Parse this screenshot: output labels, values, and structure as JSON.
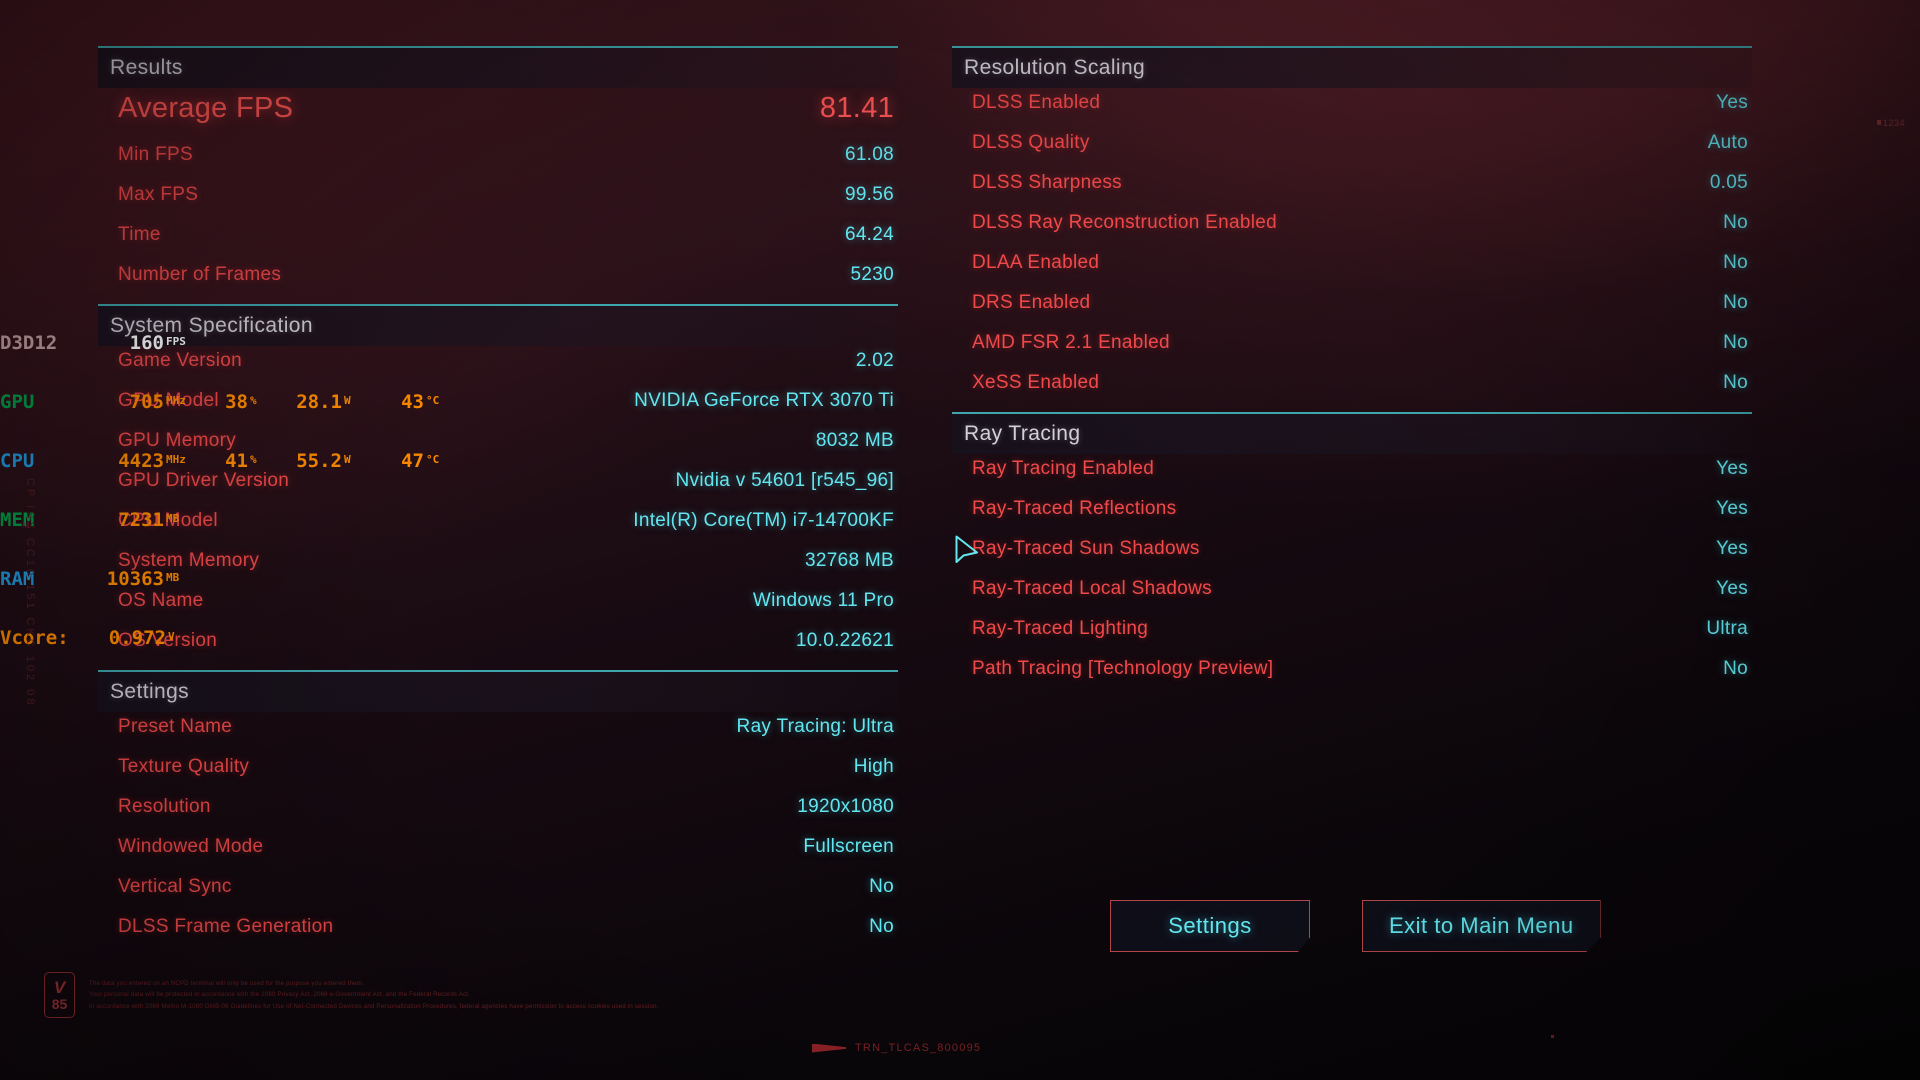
{
  "theme": {
    "accent_teal": "#3fa6ad",
    "label_red": "#f0494a",
    "value_cyan": "#63e6ef",
    "highlight_red": "#fe5453",
    "header_text": "#d3d0d6",
    "button_border": "#b4464a"
  },
  "left_column": {
    "results": {
      "title": "Results",
      "rows": [
        {
          "label": "Average FPS",
          "value": "81.41",
          "emphasis": true
        },
        {
          "label": "Min FPS",
          "value": "61.08",
          "emphasis": false
        },
        {
          "label": "Max FPS",
          "value": "99.56",
          "emphasis": false
        },
        {
          "label": "Time",
          "value": "64.24",
          "emphasis": false
        },
        {
          "label": "Number of Frames",
          "value": "5230",
          "emphasis": false
        }
      ]
    },
    "system_specification": {
      "title": "System Specification",
      "rows": [
        {
          "label": "Game Version",
          "value": "2.02"
        },
        {
          "label": "GPU Model",
          "value": "NVIDIA GeForce RTX 3070 Ti"
        },
        {
          "label": "GPU Memory",
          "value": "8032 MB"
        },
        {
          "label": "GPU Driver Version",
          "value": "Nvidia v 54601 [r545_96]"
        },
        {
          "label": "CPU Model",
          "value": "Intel(R) Core(TM) i7-14700KF"
        },
        {
          "label": "System Memory",
          "value": "32768 MB"
        },
        {
          "label": "OS Name",
          "value": "Windows 11 Pro"
        },
        {
          "label": "OS Version",
          "value": "10.0.22621"
        }
      ]
    },
    "settings": {
      "title": "Settings",
      "rows": [
        {
          "label": "Preset Name",
          "value": "Ray Tracing: Ultra"
        },
        {
          "label": "Texture Quality",
          "value": "High"
        },
        {
          "label": "Resolution",
          "value": "1920x1080"
        },
        {
          "label": "Windowed Mode",
          "value": "Fullscreen"
        },
        {
          "label": "Vertical Sync",
          "value": "No"
        },
        {
          "label": "DLSS Frame Generation",
          "value": "No"
        }
      ]
    }
  },
  "right_column": {
    "resolution_scaling": {
      "title": "Resolution Scaling",
      "rows": [
        {
          "label": "DLSS Enabled",
          "value": "Yes"
        },
        {
          "label": "DLSS Quality",
          "value": "Auto"
        },
        {
          "label": "DLSS Sharpness",
          "value": "0.05"
        },
        {
          "label": "DLSS Ray Reconstruction Enabled",
          "value": "No"
        },
        {
          "label": "DLAA Enabled",
          "value": "No"
        },
        {
          "label": "DRS Enabled",
          "value": "No"
        },
        {
          "label": "AMD FSR 2.1 Enabled",
          "value": "No"
        },
        {
          "label": "XeSS Enabled",
          "value": "No"
        }
      ]
    },
    "ray_tracing": {
      "title": "Ray Tracing",
      "rows": [
        {
          "label": "Ray Tracing Enabled",
          "value": "Yes"
        },
        {
          "label": "Ray-Traced Reflections",
          "value": "Yes"
        },
        {
          "label": "Ray-Traced Sun Shadows",
          "value": "Yes"
        },
        {
          "label": "Ray-Traced Local Shadows",
          "value": "Yes"
        },
        {
          "label": "Ray-Traced Lighting",
          "value": "Ultra"
        },
        {
          "label": "Path Tracing [Technology Preview]",
          "value": "No"
        }
      ]
    }
  },
  "buttons": {
    "settings": "Settings",
    "exit_to_main_menu": "Exit to Main Menu"
  },
  "overlay": {
    "api": {
      "label": "D3D12",
      "value": "160",
      "unit": "FPS"
    },
    "gpu": {
      "label": "GPU",
      "clock": "705",
      "clock_unit": "MHz",
      "load": "38",
      "load_unit": "%",
      "power": "28.1",
      "power_unit": "W",
      "temp": "43",
      "temp_unit": "°C"
    },
    "cpu": {
      "label": "CPU",
      "clock": "4423",
      "clock_unit": "MHz",
      "load": "41",
      "load_unit": "%",
      "power": "55.2",
      "power_unit": "W",
      "temp": "47",
      "temp_unit": "°C"
    },
    "mem": {
      "label": "MEM",
      "value": "7231",
      "unit": "MB"
    },
    "ram": {
      "label": "RAM",
      "value": "10363",
      "unit": "MB"
    },
    "vcore": {
      "label": "Vcore:",
      "value": "0.972",
      "unit": "V"
    }
  },
  "decor": {
    "version_badge_top": "V",
    "version_badge_bottom": "85",
    "legal_lines": [
      "The data you entered on an NCPD terminal will only be used for the purpose you entered them.",
      "Your personal data will be protected in accordance with the 2069 Privacy Act, 2068 e-Government Act, and the Federal Records Act.",
      "In accordance with 2069 Memo M-1080 OMB-06 Guidelines for Use of Net-Connected Devices and Personalization Procedures, federal agencies have permission to access cookies used in session."
    ],
    "watermark": "TRN_TLCAS_800095",
    "vertical_text": "CP ISS CC10 151 CKC 102 08",
    "vertical_small": "M",
    "top_right_marker": "1234"
  }
}
